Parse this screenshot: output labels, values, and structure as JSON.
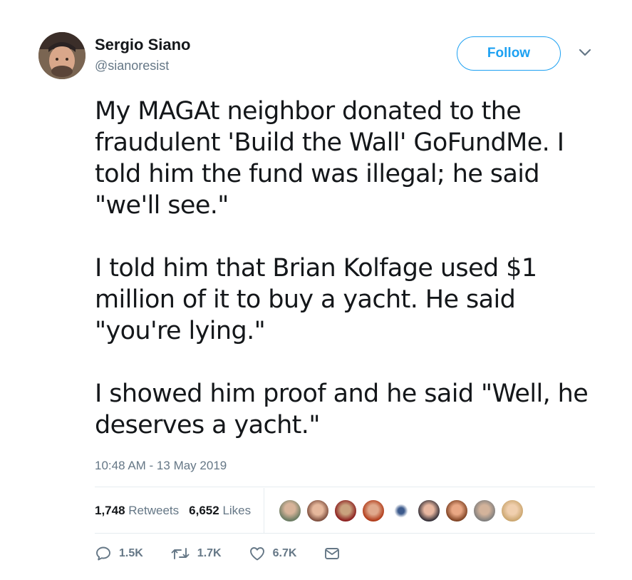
{
  "user": {
    "name": "Sergio Siano",
    "handle": "@sianoresist",
    "follow_label": "Follow"
  },
  "tweet": {
    "paragraphs": [
      "My MAGAt neighbor donated to the\nfraudulent 'Build the Wall' GoFundMe. I\ntold him the fund was illegal; he said\n\"we'll see.\"",
      "I told him that Brian Kolfage used $1\nmillion of it to buy a yacht. He said\n\"you're lying.\"",
      "I showed him proof and he said \"Well, he\ndeserves a yacht.\""
    ],
    "timestamp": "10:48 AM - 13 May 2019"
  },
  "stats": {
    "retweets_count": "1,748",
    "retweets_label": "Retweets",
    "likes_count": "6,652",
    "likes_label": "Likes"
  },
  "actions": {
    "replies": "1.5K",
    "retweets": "1.7K",
    "likes": "6.7K"
  },
  "colors": {
    "accent": "#1da1f2",
    "secondary_text": "#657786",
    "divider": "#e6ecf0"
  }
}
